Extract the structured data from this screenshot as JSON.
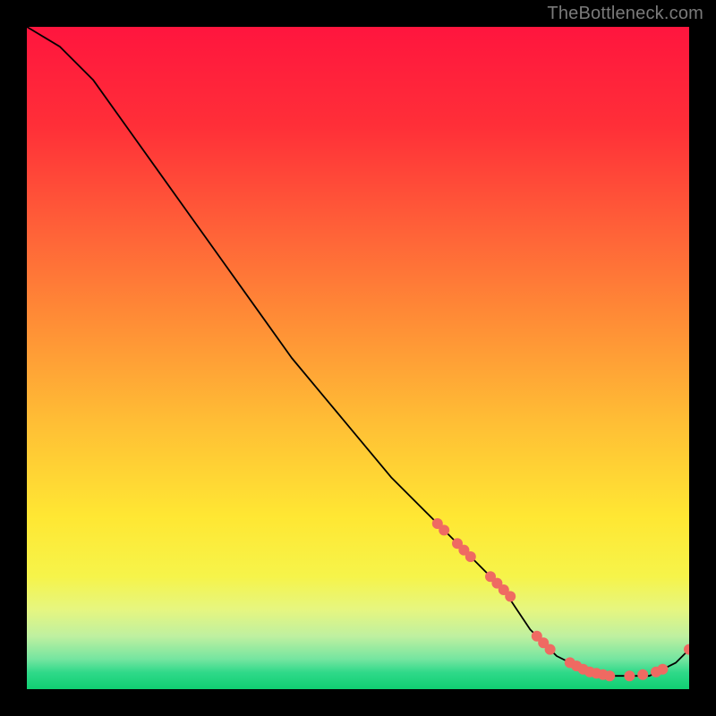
{
  "watermark": "TheBottleneck.com",
  "chart_data": {
    "type": "line",
    "title": "",
    "xlabel": "",
    "ylabel": "",
    "xlim": [
      0,
      100
    ],
    "ylim": [
      0,
      100
    ],
    "grid": false,
    "series": [
      {
        "name": "curve",
        "style": "line",
        "color": "#000000",
        "x": [
          0,
          5,
          10,
          15,
          20,
          25,
          30,
          35,
          40,
          45,
          50,
          55,
          60,
          62,
          64,
          66,
          68,
          70,
          72,
          74,
          76,
          78,
          80,
          82,
          84,
          86,
          88,
          90,
          92,
          94,
          96,
          98,
          100
        ],
        "y": [
          100,
          97,
          92,
          85,
          78,
          71,
          64,
          57,
          50,
          44,
          38,
          32,
          27,
          25,
          23,
          21,
          19,
          17,
          15,
          12,
          9,
          7,
          5,
          4,
          3,
          2,
          2,
          2,
          2,
          2,
          3,
          4,
          6
        ]
      },
      {
        "name": "highlight-dots",
        "style": "markers",
        "color": "#ef6a62",
        "x": [
          62,
          63,
          65,
          66,
          67,
          70,
          71,
          72,
          73,
          77,
          78,
          79,
          82,
          83,
          84,
          85,
          86,
          87,
          88,
          91,
          93,
          95,
          96,
          100
        ],
        "y": [
          25,
          24,
          22,
          21,
          20,
          17,
          16,
          15,
          14,
          8,
          7,
          6,
          4,
          3.5,
          3,
          2.6,
          2.4,
          2.2,
          2,
          2,
          2.2,
          2.6,
          3,
          6
        ]
      }
    ],
    "background_gradient": {
      "type": "vertical",
      "stops": [
        {
          "pos": 0.0,
          "color": "#ff153e"
        },
        {
          "pos": 0.15,
          "color": "#ff2f38"
        },
        {
          "pos": 0.3,
          "color": "#ff5f38"
        },
        {
          "pos": 0.45,
          "color": "#ff8f36"
        },
        {
          "pos": 0.6,
          "color": "#ffbf35"
        },
        {
          "pos": 0.74,
          "color": "#ffe733"
        },
        {
          "pos": 0.83,
          "color": "#f6f44a"
        },
        {
          "pos": 0.88,
          "color": "#e6f680"
        },
        {
          "pos": 0.92,
          "color": "#bff0a0"
        },
        {
          "pos": 0.955,
          "color": "#74e5a0"
        },
        {
          "pos": 0.975,
          "color": "#2fd989"
        },
        {
          "pos": 1.0,
          "color": "#10cf72"
        }
      ]
    }
  }
}
